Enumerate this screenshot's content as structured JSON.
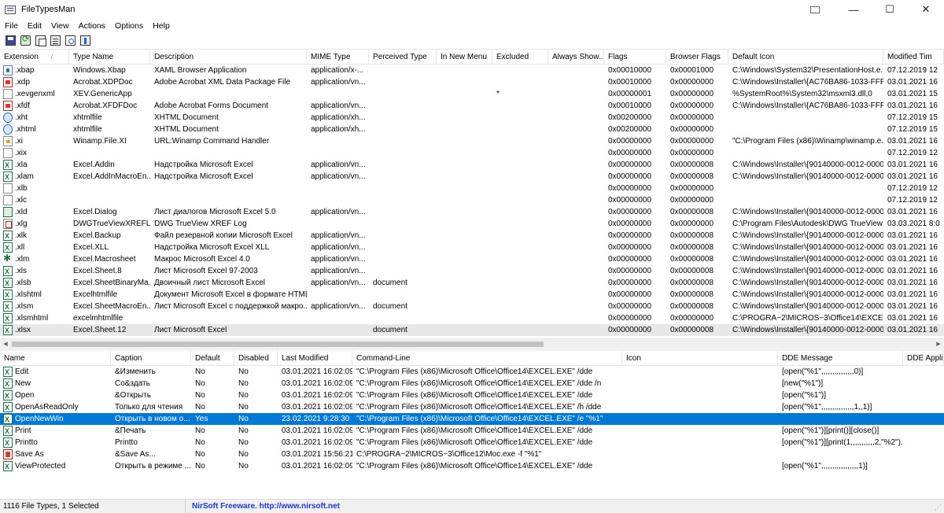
{
  "app": {
    "title": "FileTypesMan",
    "controls": {
      "minimize": "—",
      "maximize": "☐",
      "close": "✕"
    }
  },
  "menu": [
    "File",
    "Edit",
    "View",
    "Actions",
    "Options",
    "Help"
  ],
  "toolbar": [
    "save-icon",
    "refresh-icon",
    "copy-icon",
    "properties-icon",
    "find-icon",
    "exit-icon"
  ],
  "file_types": {
    "columns": [
      "Extension",
      "Type Name",
      "Description",
      "MIME Type",
      "Perceived Type",
      "In New Menu",
      "Excluded",
      "Always Show...",
      "Flags",
      "Browser Flags",
      "Default Icon",
      "Modified Tim"
    ],
    "rows": [
      {
        "icon": "xaml",
        "ext": ".xbap",
        "type": "Windows.Xbap",
        "desc": "XAML Browser Application",
        "mime": "application/x-...",
        "perceived": "",
        "newmenu": "",
        "excluded": "",
        "always": "",
        "flags": "0x00010000",
        "bflags": "0x00001000",
        "icon_path": "C:\\Windows\\System32\\PresentationHost.e...",
        "modified": "07.12.2019 12"
      },
      {
        "icon": "pdf",
        "ext": ".xdp",
        "type": "Acrobat.XDPDoc",
        "desc": "Adobe Acrobat XML Data Package File",
        "mime": "application/vn...",
        "perceived": "",
        "newmenu": "",
        "excluded": "",
        "always": "",
        "flags": "0x00010000",
        "bflags": "0x00000000",
        "icon_path": "C:\\Windows\\Installer\\{AC76BA86-1033-FFF...",
        "modified": "03.01.2021 16"
      },
      {
        "icon": "generic",
        "ext": ".xevgenxml",
        "type": "XEV.GenericApp",
        "desc": "",
        "mime": "",
        "perceived": "",
        "newmenu": "",
        "excluded": "*",
        "always": "",
        "flags": "0x00000001",
        "bflags": "0x00000000",
        "icon_path": "%SystemRoot%\\System32\\msxml3.dll,0",
        "modified": "03.01.2021 15"
      },
      {
        "icon": "pdf",
        "ext": ".xfdf",
        "type": "Acrobat.XFDFDoc",
        "desc": "Adobe Acrobat Forms Document",
        "mime": "application/vn...",
        "perceived": "",
        "newmenu": "",
        "excluded": "",
        "always": "",
        "flags": "0x00010000",
        "bflags": "0x00000000",
        "icon_path": "C:\\Windows\\Installer\\{AC76BA86-1033-FFF...",
        "modified": "03.01.2021 16"
      },
      {
        "icon": "web",
        "ext": ".xht",
        "type": "xhtmlfile",
        "desc": "XHTML Document",
        "mime": "application/xh...",
        "perceived": "",
        "newmenu": "",
        "excluded": "",
        "always": "",
        "flags": "0x00200000",
        "bflags": "0x00000000",
        "icon_path": "",
        "modified": "07.12.2019 15"
      },
      {
        "icon": "web",
        "ext": ".xhtml",
        "type": "xhtmlfile",
        "desc": "XHTML Document",
        "mime": "application/xh...",
        "perceived": "",
        "newmenu": "",
        "excluded": "",
        "always": "",
        "flags": "0x00200000",
        "bflags": "0x00000000",
        "icon_path": "",
        "modified": "07.12.2019 15"
      },
      {
        "icon": "winamp",
        "ext": ".xi",
        "type": "Winamp.File.XI",
        "desc": "URL:Winamp Command Handler",
        "mime": "",
        "perceived": "",
        "newmenu": "",
        "excluded": "",
        "always": "",
        "flags": "0x00000000",
        "bflags": "0x00000000",
        "icon_path": "\"C:\\Program Files (x86)\\Winamp\\winamp.e...",
        "modified": "03.01.2021 16"
      },
      {
        "icon": "generic",
        "ext": ".xix",
        "type": "",
        "desc": "",
        "mime": "",
        "perceived": "",
        "newmenu": "",
        "excluded": "",
        "always": "",
        "flags": "0x00000000",
        "bflags": "0x00000000",
        "icon_path": "",
        "modified": "07.12.2019 12"
      },
      {
        "icon": "excel",
        "ext": ".xla",
        "type": "Excel.Addin",
        "desc": "Надстройка Microsoft Excel",
        "mime": "application/vn...",
        "perceived": "",
        "newmenu": "",
        "excluded": "",
        "always": "",
        "flags": "0x00000000",
        "bflags": "0x00000008",
        "icon_path": "C:\\Windows\\Installer\\{90140000-0012-0000...",
        "modified": "03.01.2021 16"
      },
      {
        "icon": "excel",
        "ext": ".xlam",
        "type": "Excel.AddInMacroEn...",
        "desc": "Надстройка Microsoft Excel",
        "mime": "application/vn...",
        "perceived": "",
        "newmenu": "",
        "excluded": "",
        "always": "",
        "flags": "0x00000000",
        "bflags": "0x00000008",
        "icon_path": "C:\\Windows\\Installer\\{90140000-0012-0000...",
        "modified": "03.01.2021 16"
      },
      {
        "icon": "generic",
        "ext": ".xlb",
        "type": "",
        "desc": "",
        "mime": "",
        "perceived": "",
        "newmenu": "",
        "excluded": "",
        "always": "",
        "flags": "0x00000000",
        "bflags": "0x00000000",
        "icon_path": "",
        "modified": "07.12.2019 12"
      },
      {
        "icon": "generic",
        "ext": ".xlc",
        "type": "",
        "desc": "",
        "mime": "",
        "perceived": "",
        "newmenu": "",
        "excluded": "",
        "always": "",
        "flags": "0x00000000",
        "bflags": "0x00000000",
        "icon_path": "",
        "modified": "07.12.2019 12"
      },
      {
        "icon": "dlg",
        "ext": ".xld",
        "type": "Excel.Dialog",
        "desc": "Лист диалогов Microsoft Excel 5.0",
        "mime": "application/vn...",
        "perceived": "",
        "newmenu": "",
        "excluded": "",
        "always": "",
        "flags": "0x00000000",
        "bflags": "0x00000008",
        "icon_path": "C:\\Windows\\Installer\\{90140000-0012-0000...",
        "modified": "03.01.2021 16"
      },
      {
        "icon": "dwg",
        "ext": ".xlg",
        "type": "DWGTrueViewXREFL...",
        "desc": "DWG TrueView XREF Log",
        "mime": "",
        "perceived": "",
        "newmenu": "",
        "excluded": "",
        "always": "",
        "flags": "0x00000000",
        "bflags": "0x00000000",
        "icon_path": "C:\\Program Files\\Autodesk\\DWG TrueView ...",
        "modified": "03.03.2021 8:0"
      },
      {
        "icon": "excel",
        "ext": ".xlk",
        "type": "Excel.Backup",
        "desc": "Файл резервной копии Microsoft Excel",
        "mime": "application/vn...",
        "perceived": "",
        "newmenu": "",
        "excluded": "",
        "always": "",
        "flags": "0x00000000",
        "bflags": "0x00000008",
        "icon_path": "C:\\Windows\\Installer\\{90140000-0012-0000...",
        "modified": "03.01.2021 16"
      },
      {
        "icon": "excel",
        "ext": ".xll",
        "type": "Excel.XLL",
        "desc": "Надстройка Microsoft Excel XLL",
        "mime": "application/vn...",
        "perceived": "",
        "newmenu": "",
        "excluded": "",
        "always": "",
        "flags": "0x00000000",
        "bflags": "0x00000008",
        "icon_path": "C:\\Windows\\Installer\\{90140000-0012-0000...",
        "modified": "03.01.2021 16"
      },
      {
        "icon": "macro",
        "ext": ".xlm",
        "type": "Excel.Macrosheet",
        "desc": "Макрос Microsoft Excel 4.0",
        "mime": "application/vn...",
        "perceived": "",
        "newmenu": "",
        "excluded": "",
        "always": "",
        "flags": "0x00000000",
        "bflags": "0x00000008",
        "icon_path": "C:\\Windows\\Installer\\{90140000-0012-0000...",
        "modified": "03.01.2021 16"
      },
      {
        "icon": "excel",
        "ext": ".xls",
        "type": "Excel.Sheet.8",
        "desc": "Лист Microsoft Excel 97-2003",
        "mime": "application/vn...",
        "perceived": "",
        "newmenu": "",
        "excluded": "",
        "always": "",
        "flags": "0x00000000",
        "bflags": "0x00000008",
        "icon_path": "C:\\Windows\\Installer\\{90140000-0012-0000...",
        "modified": "03.01.2021 16"
      },
      {
        "icon": "excel",
        "ext": ".xlsb",
        "type": "Excel.SheetBinaryMa...",
        "desc": "Двоичный лист Microsoft Excel",
        "mime": "application/vn...",
        "perceived": "document",
        "newmenu": "",
        "excluded": "",
        "always": "",
        "flags": "0x00000000",
        "bflags": "0x00000008",
        "icon_path": "C:\\Windows\\Installer\\{90140000-0012-0000...",
        "modified": "03.01.2021 16"
      },
      {
        "icon": "excel",
        "ext": ".xlshtml",
        "type": "Excelhtmlfile",
        "desc": "Документ Microsoft Excel в формате HTML",
        "mime": "",
        "perceived": "",
        "newmenu": "",
        "excluded": "",
        "always": "",
        "flags": "0x00000000",
        "bflags": "0x00000008",
        "icon_path": "C:\\Windows\\Installer\\{90140000-0012-0000...",
        "modified": "03.01.2021 16"
      },
      {
        "icon": "excel",
        "ext": ".xlsm",
        "type": "Excel.SheetMacroEn...",
        "desc": "Лист Microsoft Excel с поддержкой макро...",
        "mime": "application/vn...",
        "perceived": "document",
        "newmenu": "",
        "excluded": "",
        "always": "",
        "flags": "0x00000000",
        "bflags": "0x00000008",
        "icon_path": "C:\\Windows\\Installer\\{90140000-0012-0000...",
        "modified": "03.01.2021 16"
      },
      {
        "icon": "excel",
        "ext": ".xlsmhtml",
        "type": "excelmhtmlfile",
        "desc": "",
        "mime": "",
        "perceived": "",
        "newmenu": "",
        "excluded": "",
        "always": "",
        "flags": "0x00000000",
        "bflags": "0x00000000",
        "icon_path": "C:\\PROGRA~2\\MICROS~3\\Office14\\EXCEL...",
        "modified": "03.01.2021 16"
      },
      {
        "icon": "excel",
        "ext": ".xlsx",
        "type": "Excel.Sheet.12",
        "desc": "Лист Microsoft Excel",
        "mime": "",
        "perceived": "document",
        "newmenu": "",
        "excluded": "",
        "always": "",
        "flags": "0x00000000",
        "bflags": "0x00000008",
        "icon_path": "C:\\Windows\\Installer\\{90140000-0012-0000...",
        "modified": "03.01.2021 16"
      }
    ]
  },
  "actions": {
    "columns": [
      "Name",
      "Caption",
      "Default",
      "Disabled",
      "Last Modified",
      "Command-Line",
      "Icon",
      "DDE Message",
      "DDE Applic"
    ],
    "rows": [
      {
        "icon": "verb",
        "name": "Edit",
        "caption": "&Изменить",
        "default": "No",
        "disabled": "No",
        "modified": "03.01.2021 16:02:09",
        "cmd": "\"C:\\Program Files (x86)\\Microsoft Office\\Office14\\EXCEL.EXE\" /dde",
        "ico": "",
        "dde": "[open(\"%1\",,,,,,,,,,,,,,,0)]",
        "ddeapp": ""
      },
      {
        "icon": "verb",
        "name": "New",
        "caption": "Со&здать",
        "default": "No",
        "disabled": "No",
        "modified": "03.01.2021 16:02:09",
        "cmd": "\"C:\\Program Files (x86)\\Microsoft Office\\Office14\\EXCEL.EXE\" /dde /n",
        "ico": "",
        "dde": "[new(\"%1\")]",
        "ddeapp": ""
      },
      {
        "icon": "verb",
        "name": "Open",
        "caption": "&Открыть",
        "default": "No",
        "disabled": "No",
        "modified": "03.01.2021 16:02:09",
        "cmd": "\"C:\\Program Files (x86)\\Microsoft Office\\Office14\\EXCEL.EXE\" /dde",
        "ico": "",
        "dde": "[open(\"%1\")]",
        "ddeapp": ""
      },
      {
        "icon": "verb",
        "name": "OpenAsReadOnly",
        "caption": "Только для чтения",
        "default": "No",
        "disabled": "No",
        "modified": "03.01.2021 16:02:09",
        "cmd": "\"C:\\Program Files (x86)\\Microsoft Office\\Office14\\EXCEL.EXE\" /h /dde",
        "ico": "",
        "dde": "[open(\"%1\",,,,,,,,,,,,,,,1,,1)]",
        "ddeapp": ""
      },
      {
        "icon": "verb",
        "name": "OpenNewWin",
        "caption": "Открыть в новом о...",
        "default": "Yes",
        "disabled": "No",
        "modified": "23.02.2021 9:28:30",
        "cmd": "\"C:\\Program Files (x86)\\Microsoft Office\\Office14\\EXCEL.EXE\" /e \"%1\"",
        "ico": "",
        "dde": "",
        "ddeapp": ""
      },
      {
        "icon": "verb",
        "name": "Print",
        "caption": "&Печать",
        "default": "No",
        "disabled": "No",
        "modified": "03.01.2021 16:02:09",
        "cmd": "\"C:\\Program Files (x86)\\Microsoft Office\\Office14\\EXCEL.EXE\" /dde",
        "ico": "",
        "dde": "[open(\"%1\")][print()][close()]",
        "ddeapp": ""
      },
      {
        "icon": "verb",
        "name": "Printto",
        "caption": "Printto",
        "default": "No",
        "disabled": "No",
        "modified": "03.01.2021 16:02:09",
        "cmd": "\"C:\\Program Files (x86)\\Microsoft Office\\Office14\\EXCEL.EXE\" /dde",
        "ico": "",
        "dde": "[open(\"%1\")][print(1,,,,,,,,,,,2,\"%2\")...",
        "ddeapp": ""
      },
      {
        "icon": "saveas",
        "name": "Save As",
        "caption": "&Save As...",
        "default": "No",
        "disabled": "No",
        "modified": "03.01.2021 15:56:21",
        "cmd": "C:\\PROGRA~2\\MICROS~3\\Office12\\Moc.exe -f \"%1\"",
        "ico": "",
        "dde": "",
        "ddeapp": ""
      },
      {
        "icon": "verb",
        "name": "ViewProtected",
        "caption": "Открыть в режиме ...",
        "default": "No",
        "disabled": "No",
        "modified": "03.01.2021 16:02:09",
        "cmd": "\"C:\\Program Files (x86)\\Microsoft Office\\Office14\\EXCEL.EXE\" /dde",
        "ico": "",
        "dde": "[open(\"%1\",,,,,,,,,,,,,,,,,1)]",
        "ddeapp": ""
      }
    ]
  },
  "status": {
    "count": "1116 File Types, 1 Selected",
    "link": "NirSoft Freeware.  http://www.nirsoft.net"
  }
}
